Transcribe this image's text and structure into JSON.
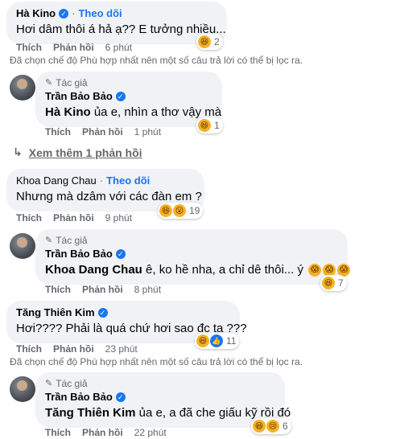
{
  "c1": {
    "author": "Hà Kino",
    "follow": "Theo dõi",
    "text": "Hơi dâm thôi á hả ạ?? E tưởng nhiều...",
    "like": "Thích",
    "reply": "Phản hồi",
    "time": "6 phút",
    "reaction_count": "2"
  },
  "notice1": "Đã chọn chế độ Phù hợp nhất nên một số câu trả lời có thể bị lọc ra.",
  "r1": {
    "tag": "Tác giả",
    "author": "Trần Bảo Bảo",
    "mention": "Hà Kino",
    "text": " ủa e, nhìn a thơ vậy mà",
    "like": "Thích",
    "reply": "Phản hồi",
    "time": "1 phút",
    "reaction_count": "1"
  },
  "more": "Xem thêm 1 phản hồi",
  "c2": {
    "author": "Khoa Dang Chau",
    "follow": "Theo dõi",
    "text": "Nhưng mà dzâm với các đàn em ?",
    "like": "Thích",
    "reply": "Phản hồi",
    "time": "9 phút",
    "reaction_count": "19"
  },
  "r2": {
    "tag": "Tác giả",
    "author": "Trần Bảo Bảo",
    "mention": "Khoa Dang Chau",
    "text": " ê, ko hề nha, a chỉ dê thôi... ý",
    "like": "Thích",
    "reply": "Phản hồi",
    "time": "8 phút",
    "reaction_count": "7"
  },
  "c3": {
    "author": "Tăng Thiên Kim",
    "text": "Hơi???? Phải là quá chứ hơi sao đc ta ???",
    "like": "Thích",
    "reply": "Phản hồi",
    "time": "23 phút",
    "reaction_count": "11"
  },
  "notice2": "Đã chọn chế độ Phù hợp nhất nên một số câu trả lời có thể bị lọc ra.",
  "r3": {
    "tag": "Tác giả",
    "author": "Trần Bảo Bảo",
    "mention": "Tăng Thiên Kim",
    "text": " ủa e, a đã che giấu kỹ rồi đó",
    "like": "Thích",
    "reply": "Phản hồi",
    "time": "22 phút",
    "reaction_count": "6"
  },
  "icons": {
    "verified": "✓",
    "follow_dot": "·",
    "pen": "✎",
    "reply_arrow": "↳",
    "haha": "😆",
    "wow": "😮",
    "like": "👍",
    "sad": "😢",
    "scream": "😱"
  }
}
